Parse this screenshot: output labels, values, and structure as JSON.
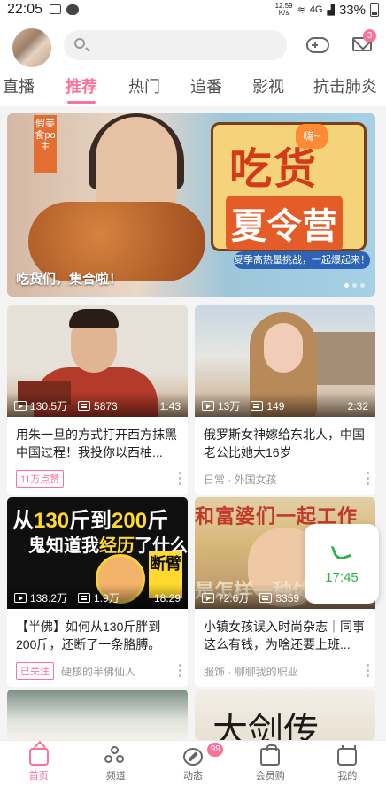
{
  "status_bar": {
    "time": "22:05",
    "net_speed_value": "12.59",
    "net_speed_unit": "K/s",
    "network": "4G",
    "battery": "33%"
  },
  "header": {
    "search_placeholder": "",
    "mail_badge": "3"
  },
  "tabs": [
    {
      "label": "直播",
      "active": false
    },
    {
      "label": "推荐",
      "active": true
    },
    {
      "label": "热门",
      "active": false
    },
    {
      "label": "追番",
      "active": false
    },
    {
      "label": "影视",
      "active": false
    },
    {
      "label": "抗击肺炎",
      "active": false
    }
  ],
  "banner": {
    "caption": "吃货们，集合啦！",
    "tag": "假美食po主",
    "title_line1": "吃货",
    "title_line2": "夏令营",
    "speech": "嗨~",
    "subtitle": "夏季高热量挑战，一起爆起来！"
  },
  "cards": [
    {
      "views": "130.5万",
      "danmaku": "5873",
      "duration": "1:43",
      "title": "用朱一旦的方式打开西方抹黑中国过程！我投你以西柚...",
      "badge": "11万点赞",
      "meta": ""
    },
    {
      "views": "13万",
      "danmaku": "149",
      "duration": "2:32",
      "title": "俄罗斯女神嫁给东北人，中国老公比她大16岁",
      "badge": "",
      "meta": "日常 · 外国女孩"
    },
    {
      "views": "138.2万",
      "danmaku": "1.9万",
      "duration": "18:29",
      "title": "【半佛】如何从130斤胖到200斤，还断了一条胳膊。",
      "badge": "已关注",
      "meta": "硬核的半佛仙人",
      "art_line1_a": "从",
      "art_line1_b": "130",
      "art_line1_c": "斤到",
      "art_line1_d": "200",
      "art_line1_e": "斤",
      "art_line2_a": "鬼知道我",
      "art_line2_b": "经历",
      "art_line2_c": "了什么",
      "art_tag": "断臂"
    },
    {
      "views": "72.6万",
      "danmaku": "3359",
      "duration": "",
      "title": "小镇女孩误入时尚杂志｜同事这么有钱，为啥还要上班...",
      "badge": "",
      "meta": "服饰 · 聊聊我的职业",
      "art_top": "和富婆们一起工作",
      "art_bottom": "是怎样一种体验"
    }
  ],
  "call_widget": {
    "time": "17:45"
  },
  "bottom_nav": [
    {
      "label": "首页",
      "active": true,
      "icon": "home-icon"
    },
    {
      "label": "频道",
      "active": false,
      "icon": "channel-icon"
    },
    {
      "label": "动态",
      "active": false,
      "icon": "dynamic-icon",
      "badge": "99"
    },
    {
      "label": "会员购",
      "active": false,
      "icon": "shop-icon"
    },
    {
      "label": "我的",
      "active": false,
      "icon": "mine-icon"
    }
  ],
  "colors": {
    "accent": "#fb7299",
    "call_green": "#2bb24c"
  }
}
